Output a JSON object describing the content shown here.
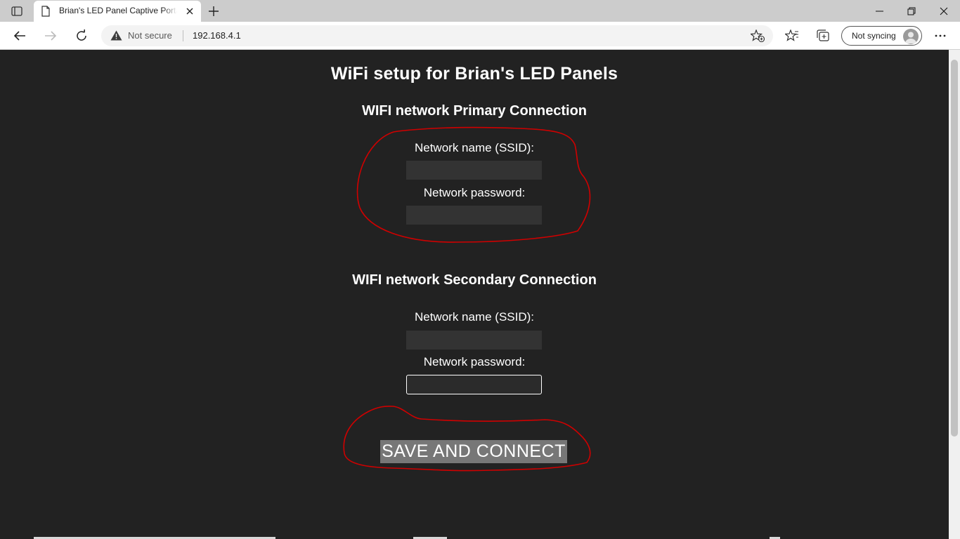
{
  "browser": {
    "tab_title": "Brian's LED Panel Captive Portal P",
    "address": {
      "security_label": "Not secure",
      "url": "192.168.4.1"
    },
    "sync_label": "Not syncing"
  },
  "page": {
    "title": "WiFi setup for Brian's LED Panels",
    "primary": {
      "heading": "WIFI network Primary Connection",
      "ssid_label": "Network name (SSID):",
      "ssid_value": "",
      "password_label": "Network password:",
      "password_value": ""
    },
    "secondary": {
      "heading": "WIFI network Secondary Connection",
      "ssid_label": "Network name (SSID):",
      "ssid_value": "",
      "password_label": "Network password:",
      "password_value": ""
    },
    "submit_label": "SAVE AND CONNECT"
  },
  "colors": {
    "page_background": "#222222",
    "input_background": "#333333",
    "button_background": "#777777",
    "annotation": "#d00000"
  },
  "icons": [
    "tab-actions-icon",
    "page-icon",
    "close-icon",
    "plus-icon",
    "minimize-icon",
    "restore-icon",
    "back-arrow-icon",
    "forward-arrow-icon",
    "refresh-icon",
    "warning-icon",
    "add-favorite-icon",
    "favorites-icon",
    "collections-icon",
    "profile-avatar-icon",
    "more-icon"
  ]
}
